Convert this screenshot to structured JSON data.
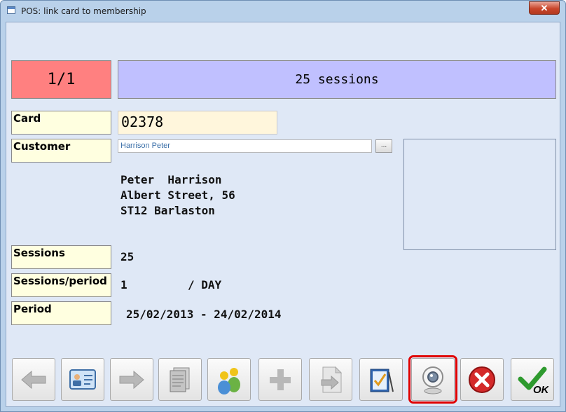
{
  "window": {
    "title": "POS: link card to membership",
    "close_glyph": "✕"
  },
  "header": {
    "counter": "1/1",
    "title": "25 sessions"
  },
  "fields": {
    "card_label": "Card",
    "card_value": "02378",
    "customer_label": "Customer",
    "customer_value": "Harrison Peter",
    "customer_browse": "...",
    "sessions_label": "Sessions",
    "sessions_value": "25",
    "sessions_period_label": "Sessions/period",
    "sessions_period_value": "1",
    "sessions_period_unit": "/ DAY",
    "period_label": "Period",
    "period_value": "25/02/2013 - 24/02/2014"
  },
  "address": {
    "name": "Peter  Harrison",
    "street": "Albert Street, 56",
    "city": "ST12 Barlaston"
  },
  "toolbar": {
    "buttons": [
      {
        "icon": "arrow-left-icon",
        "enabled": false
      },
      {
        "icon": "id-card-icon",
        "enabled": true
      },
      {
        "icon": "arrow-right-icon",
        "enabled": false
      },
      {
        "icon": "documents-icon",
        "enabled": false
      },
      {
        "icon": "group-icon",
        "enabled": true
      },
      {
        "icon": "plus-icon",
        "enabled": false
      },
      {
        "icon": "export-document-icon",
        "enabled": false
      },
      {
        "icon": "checklist-icon",
        "enabled": true
      },
      {
        "icon": "webcam-icon",
        "enabled": true,
        "selected": true
      },
      {
        "icon": "cancel-icon",
        "enabled": true
      },
      {
        "icon": "ok-check-icon",
        "enabled": true,
        "label": "OK"
      }
    ]
  },
  "colors": {
    "counter_bg": "#ff8080",
    "header_bg": "#c0c0ff",
    "label_bg": "#ffffe0",
    "card_input_bg": "#fff6dc",
    "selection_outline": "#e00000"
  }
}
